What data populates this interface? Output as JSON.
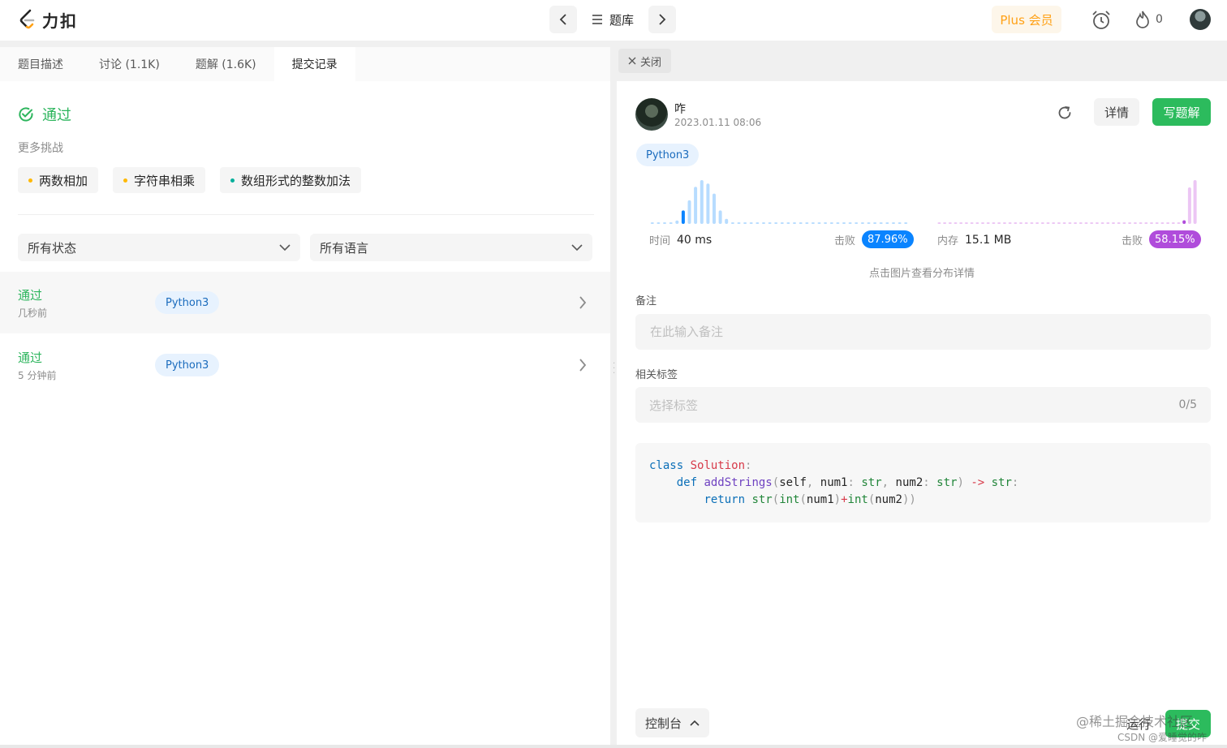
{
  "app": {
    "logo_text": "力扣"
  },
  "topnav": {
    "problems_label": "题库",
    "plus_label": "Plus 会员",
    "streak_count": "0"
  },
  "left": {
    "tabs": [
      "题目描述",
      "讨论 (1.1K)",
      "题解 (1.6K)",
      "提交记录"
    ],
    "active_tab": 3,
    "result": "通过",
    "more_title": "更多挑战",
    "challenges": [
      {
        "label": "两数相加",
        "color": "#ffb800"
      },
      {
        "label": "字符串相乘",
        "color": "#ffb800"
      },
      {
        "label": "数组形式的整数加法",
        "color": "#00af9b"
      }
    ],
    "filters": {
      "status": "所有状态",
      "language": "所有语言"
    },
    "submissions": [
      {
        "status": "通过",
        "time": "几秒前",
        "lang": "Python3"
      },
      {
        "status": "通过",
        "time": "5 分钟前",
        "lang": "Python3"
      }
    ]
  },
  "right": {
    "close_label": "关闭",
    "user": "咋",
    "time": "2023.01.11 08:06",
    "detail_label": "详情",
    "write_label": "写题解",
    "lang": "Python3",
    "runtime": {
      "label": "时间",
      "value": "40 ms",
      "beat_label": "击败",
      "beat": "87.96%",
      "color": "#0a84ff"
    },
    "memory": {
      "label": "内存",
      "value": "15.1 MB",
      "beat_label": "击败",
      "beat": "58.15%",
      "color": "#b04cdb"
    },
    "chart_hint": "点击图片查看分布详情",
    "note_label": "备注",
    "note_placeholder": "在此输入备注",
    "tags_label": "相关标签",
    "tags_placeholder": "选择标签",
    "tags_count": "0/5",
    "console_label": "控制台",
    "run_label": "运行",
    "submit_label": "提交",
    "watermark_1": "@稀土掘金技术社区",
    "watermark_2": "CSDN @爱睡觉的咋"
  },
  "distribution": {
    "runtime_bars": [
      1,
      1,
      1,
      1,
      2,
      8,
      14,
      22,
      26,
      24,
      18,
      8,
      3,
      1,
      1,
      1,
      1,
      1,
      1,
      1,
      1,
      1,
      1,
      1,
      1,
      1,
      1,
      1,
      1,
      1,
      1,
      1,
      1,
      1,
      1,
      1,
      1,
      1,
      1,
      1,
      1,
      1
    ],
    "runtime_highlight": 5,
    "memory_bars": [
      1,
      1,
      1,
      1,
      1,
      1,
      1,
      1,
      1,
      1,
      1,
      1,
      1,
      1,
      1,
      1,
      1,
      1,
      1,
      1,
      1,
      1,
      1,
      1,
      1,
      1,
      1,
      1,
      1,
      1,
      1,
      1,
      1,
      1,
      1,
      1,
      1,
      1,
      1,
      1,
      1,
      1,
      1,
      1,
      1,
      2,
      20,
      24
    ],
    "memory_highlight": 45
  }
}
